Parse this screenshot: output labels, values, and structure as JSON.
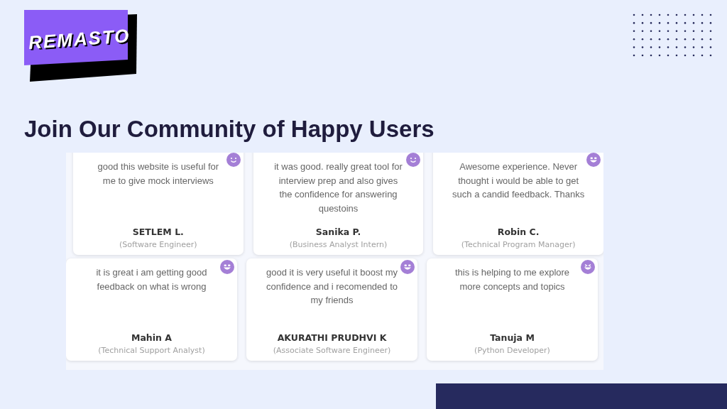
{
  "logo": {
    "text": "REMASTO"
  },
  "title": "Join Our Community of Happy Users",
  "testimonials": [
    [
      {
        "quote": "good this website is useful for me to give mock interviews",
        "name": "SETLEM L.",
        "role": "(Software Engineer)",
        "kind": "smile"
      },
      {
        "quote": "it was good. really great tool for interview prep and also gives the confidence for answering questoins",
        "name": "Sanika P.",
        "role": "(Business Analyst Intern)",
        "kind": "smile"
      },
      {
        "quote": "Awesome experience. Never thought i would be able to get such a candid feedback. Thanks",
        "name": "Robin C.",
        "role": "(Technical Program Manager)",
        "kind": "grin"
      }
    ],
    [
      {
        "quote": "it is great i am getting good feedback on what is wrong",
        "name": "Mahin A",
        "role": "(Technical Support Analyst)",
        "kind": "grin"
      },
      {
        "quote": "good it is very useful it boost my confidence and i recomended to my friends",
        "name": "AKURATHI PRUDHVI K",
        "role": "(Associate Software Engineer)",
        "kind": "grin"
      },
      {
        "quote": "this is helping to me explore more concepts and topics",
        "name": "Tanuja M",
        "role": "(Python Developer)",
        "kind": "laugh"
      }
    ]
  ]
}
